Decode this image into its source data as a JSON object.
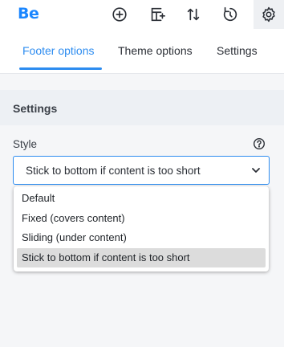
{
  "app": {
    "logo_text": "Be"
  },
  "toolbar": {
    "icons": [
      "add-circle-icon",
      "layout-add-icon",
      "sort-arrows-icon",
      "history-icon",
      "gear-icon"
    ]
  },
  "tabs": [
    {
      "label": "Footer options",
      "active": true
    },
    {
      "label": "Theme options",
      "active": false
    },
    {
      "label": "Settings",
      "active": false
    }
  ],
  "section": {
    "title": "Settings"
  },
  "style_field": {
    "label": "Style",
    "value": "Stick to bottom if content is too short",
    "options": [
      "Default",
      "Fixed (covers content)",
      "Sliding (under content)",
      "Stick to bottom if content is too short"
    ],
    "selected_index": 3
  },
  "colors": {
    "accent": "#2d8cf0",
    "logo": "#1a86ff"
  }
}
